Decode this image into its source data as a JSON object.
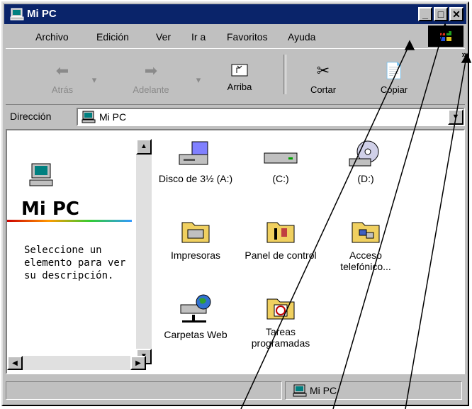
{
  "window": {
    "title": "Mi PC",
    "minimize_label": "_",
    "maximize_label": "□",
    "close_label": "✕"
  },
  "menubar": {
    "items": [
      "Archivo",
      "Edición",
      "Ver",
      "Ir a",
      "Favoritos",
      "Ayuda"
    ]
  },
  "toolbar": {
    "buttons": [
      {
        "label": "Atrás",
        "icon": "back-arrow-icon",
        "enabled": false
      },
      {
        "label": "Adelante",
        "icon": "forward-arrow-icon",
        "enabled": false
      },
      {
        "label": "Arriba",
        "icon": "up-folder-icon",
        "enabled": true
      },
      {
        "label": "Cortar",
        "icon": "scissors-icon",
        "enabled": true
      },
      {
        "label": "Copiar",
        "icon": "copy-icon",
        "enabled": true
      }
    ],
    "overflow_label": "»"
  },
  "address": {
    "label": "Dirección",
    "value": "Mi PC"
  },
  "left_pane": {
    "title": "Mi PC",
    "description": "Seleccione un elemento para ver su descripción."
  },
  "items": [
    {
      "label": "Disco de 3½ (A:)",
      "icon": "floppy-drive-icon"
    },
    {
      "label": "(C:)",
      "icon": "hard-drive-icon"
    },
    {
      "label": "(D:)",
      "icon": "cd-drive-icon"
    },
    {
      "label": "Impresoras",
      "icon": "printers-folder-icon"
    },
    {
      "label": "Panel de control",
      "icon": "control-panel-folder-icon"
    },
    {
      "label": "Acceso telefónico...",
      "icon": "dial-up-folder-icon"
    },
    {
      "label": "Carpetas Web",
      "icon": "web-folders-icon"
    },
    {
      "label": "Tareas programadas",
      "icon": "scheduled-tasks-icon"
    }
  ],
  "statusbar": {
    "location": "Mi PC"
  },
  "colors": {
    "titlebar": "#0a246a",
    "face": "#c0c0c0"
  }
}
